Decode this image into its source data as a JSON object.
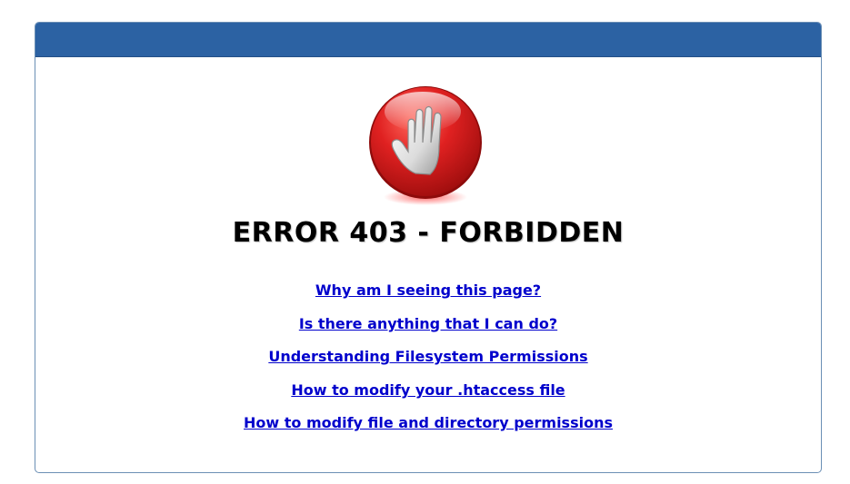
{
  "error": {
    "title": "ERROR 403 - FORBIDDEN",
    "icon": "stop-hand-icon"
  },
  "links": [
    {
      "label": "Why am I seeing this page?"
    },
    {
      "label": "Is there anything that I can do?"
    },
    {
      "label": "Understanding Filesystem Permissions"
    },
    {
      "label": "How to modify your .htaccess file"
    },
    {
      "label": "How to modify file and directory permissions"
    }
  ],
  "colors": {
    "header": "#2c62a3",
    "link": "#0000cc",
    "icon_red": "#d81e1e"
  }
}
